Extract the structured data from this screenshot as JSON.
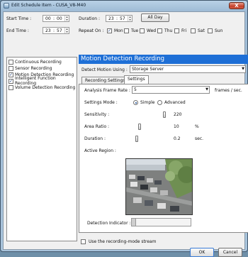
{
  "window": {
    "title": "Edit Schedule Item - CUSA_V8-M40",
    "close_label": "X"
  },
  "time": {
    "start_label": "Start Time :",
    "start_h": "00",
    "start_m": "00",
    "end_label": "End Time :",
    "end_h": "23",
    "end_m": "57",
    "duration_label": "Duration :",
    "duration_h": "23",
    "duration_m": "57",
    "all_day_label": "All Day",
    "separator": ":"
  },
  "repeat": {
    "label": "Repeat On :",
    "days": [
      {
        "label": "Mon",
        "checked": true
      },
      {
        "label": "Tue",
        "checked": false
      },
      {
        "label": "Wed",
        "checked": false
      },
      {
        "label": "Thu",
        "checked": false
      },
      {
        "label": "Fri",
        "checked": false
      },
      {
        "label": "Sat",
        "checked": false
      },
      {
        "label": "Sun",
        "checked": false
      }
    ]
  },
  "recording_list": [
    {
      "label": "Continuous Recording",
      "checked": false
    },
    {
      "label": "Sensor Recording",
      "checked": false
    },
    {
      "label": "Motion Detection Recording",
      "checked": true
    },
    {
      "label": "Intelligent Function Recording",
      "checked": true
    },
    {
      "label": "Volume Detection Recording",
      "checked": false
    }
  ],
  "panel": {
    "title": "Motion Detection Recording",
    "detect_using_label": "Detect Motion Using :",
    "detect_using_value": "Storage Server",
    "tabs": [
      "Recording Settings",
      "Settings"
    ],
    "active_tab": 1
  },
  "settings": {
    "analysis_label": "Analysis Frame Rate :",
    "analysis_value": "5",
    "analysis_unit": "frames / sec.",
    "mode_label": "Settings Mode :",
    "mode_simple": "Simple",
    "mode_advanced": "Advanced",
    "mode_selected": "Simple",
    "sensitivity_label": "Sensitivity :",
    "sensitivity_value": "220",
    "sensitivity_level": 0.86,
    "area_label": "Area Ratio :",
    "area_value": "10",
    "area_unit": "%",
    "area_level": 0.1,
    "duration_label": "Duration :",
    "duration_value": "0.2",
    "duration_unit": "sec.",
    "duration_level": 0.02,
    "region_label": "Active Region :",
    "indicator_label": "Detection Indicator :"
  },
  "footer": {
    "stream_label": "Use the recording-mode stream",
    "stream_checked": false,
    "ok_label": "OK",
    "cancel_label": "Cancel"
  },
  "colors": {
    "accent": "#1e6fd6"
  },
  "icons": {
    "window": "camera-window-icon",
    "close": "close-icon",
    "dropdown": "chevron-down-icon",
    "spin": "spin-arrows-icon"
  }
}
